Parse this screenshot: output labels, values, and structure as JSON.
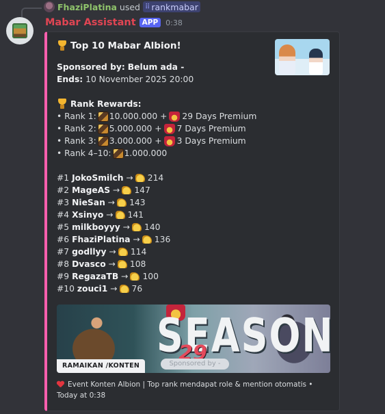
{
  "reply": {
    "username": "FhaziPlatina",
    "used_text": "used",
    "command": "rankmabar"
  },
  "message": {
    "bot_name": "Mabar Assistant",
    "app_tag": "APP",
    "timestamp": "0:38"
  },
  "embed": {
    "accent_color": "#ff5fae",
    "title": "Top 10 Mabar Albion!",
    "sponsor_label": "Sponsored by:",
    "sponsor_value": "Belum ada -",
    "ends_label": "Ends:",
    "ends_value": "10 November 2025 20:00",
    "rewards_header": "Rank Rewards:",
    "rewards": [
      {
        "rank": "• Rank 1:",
        "amount": "10.000.000",
        "plus": "+",
        "premium": "29 Days Premium"
      },
      {
        "rank": "• Rank 2:",
        "amount": "5.000.000",
        "plus": "+",
        "premium": "7 Days Premium"
      },
      {
        "rank": "• Rank 3:",
        "amount": "3.000.000",
        "plus": "+",
        "premium": "3 Days Premium"
      },
      {
        "rank": "• Rank 4–10:",
        "amount": "1.000.000"
      }
    ],
    "leaderboard": [
      {
        "pos": "#1",
        "name": "JokoSmilch",
        "arrow": "→",
        "score": "214"
      },
      {
        "pos": "#2",
        "name": "MageAS",
        "arrow": "→",
        "score": "147"
      },
      {
        "pos": "#3",
        "name": "NieSan",
        "arrow": "→",
        "score": "143"
      },
      {
        "pos": "#4",
        "name": "Xsinyo",
        "arrow": "→",
        "score": "141"
      },
      {
        "pos": "#5",
        "name": "milkboyyy",
        "arrow": "→",
        "score": "140"
      },
      {
        "pos": "#6",
        "name": "FhaziPlatina",
        "arrow": "→",
        "score": "136"
      },
      {
        "pos": "#7",
        "name": "godllyy",
        "arrow": "→",
        "score": "114"
      },
      {
        "pos": "#8",
        "name": "Dvasco",
        "arrow": "→",
        "score": "108"
      },
      {
        "pos": "#9",
        "name": "RegazaTB",
        "arrow": "→",
        "score": "100"
      },
      {
        "pos": "#10",
        "name": "zouci1",
        "arrow": "→",
        "score": "76"
      }
    ],
    "banner": {
      "season_text": "SEASON",
      "season_number": "29",
      "sponsored_text": "Sponsored by -",
      "label": "RAMAIKAN /KONTEN"
    },
    "footer_text": "Event Konten Albion | Top rank mendapat role & mention otomatis •",
    "footer_time": "Today at 0:38"
  }
}
